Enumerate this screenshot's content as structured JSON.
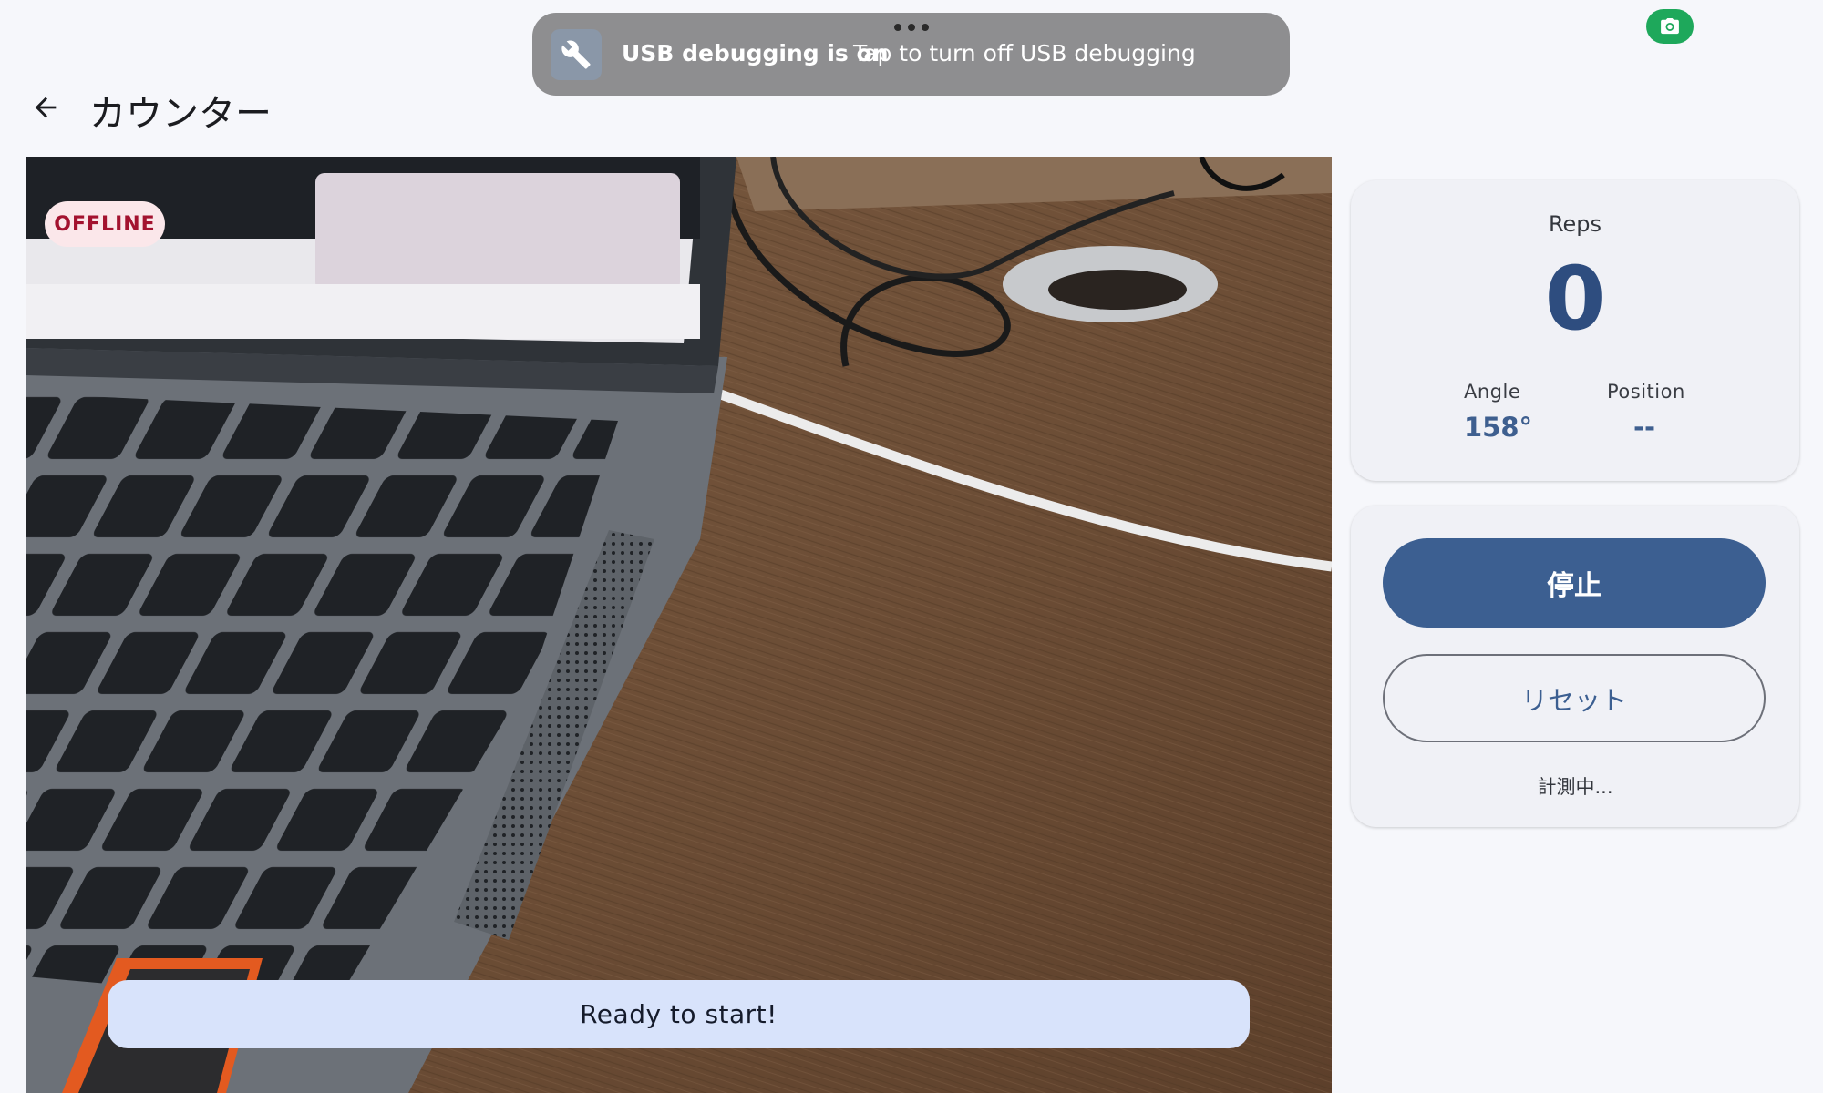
{
  "notification": {
    "title": "USB debugging is on",
    "subtitle": "Tap to turn off USB debugging",
    "icon": "wrench-icon"
  },
  "status_bar": {
    "camera_indicator_icon": "camera-icon",
    "camera_indicator_color": "#1ea85b"
  },
  "app_bar": {
    "back_icon": "arrow-back-icon",
    "title": "カウンター"
  },
  "camera": {
    "connection_badge": "OFFLINE",
    "status_message": "Ready to start!"
  },
  "stats": {
    "reps_label": "Reps",
    "reps_value": "0",
    "angle_label": "Angle",
    "angle_value": "158°",
    "position_label": "Position",
    "position_value": "--"
  },
  "controls": {
    "stop_label": "停止",
    "reset_label": "リセット",
    "status_text": "計測中..."
  },
  "colors": {
    "primary": "#3c5f91",
    "background": "#f6f7fb",
    "offline_badge_bg": "#fbe7ea",
    "offline_badge_text": "#a3122f",
    "status_pill_bg": "#d8e3fb"
  }
}
